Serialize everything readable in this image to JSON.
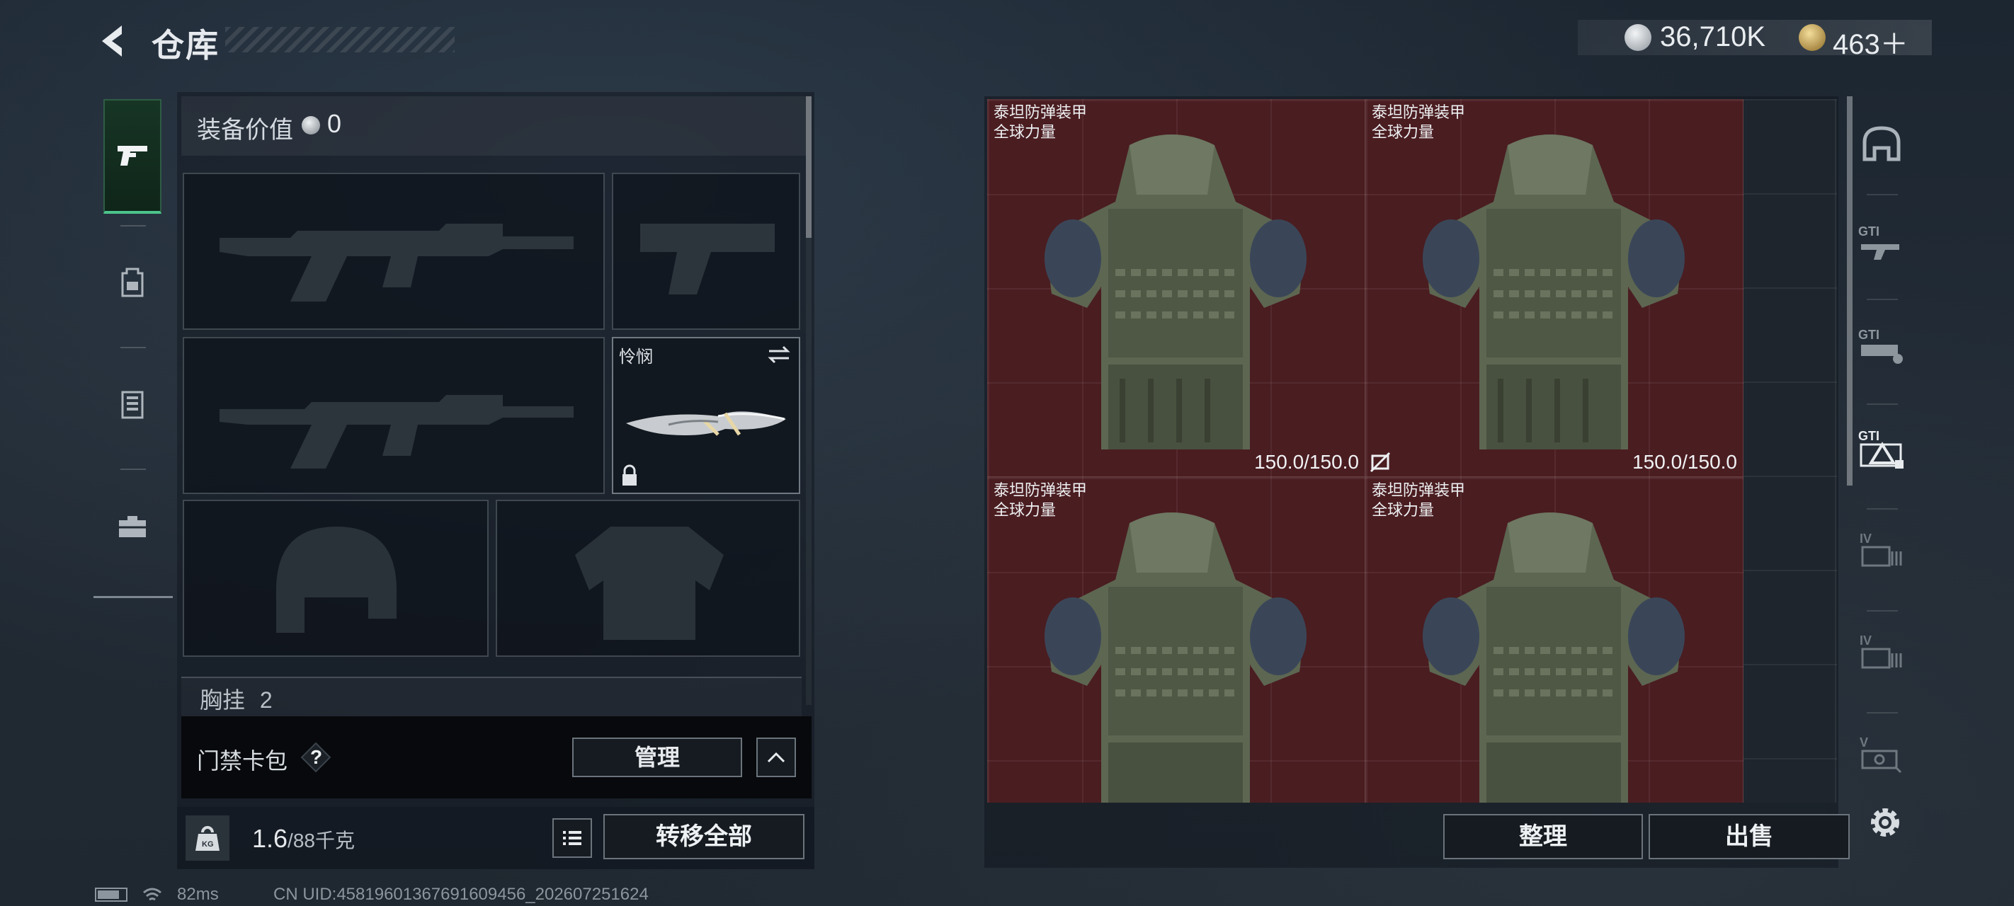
{
  "header": {
    "title": "仓库",
    "currencies": [
      {
        "name": "silver-coin",
        "value": "36,710K",
        "color": "#bfc4c9"
      },
      {
        "name": "gold-coin",
        "value": "463＋",
        "color": "#c9a55a"
      }
    ]
  },
  "side_tabs": [
    {
      "icon": "pistol-icon",
      "active": true
    },
    {
      "icon": "backpack-icon",
      "active": false
    },
    {
      "icon": "rig-icon",
      "active": false
    },
    {
      "icon": "case-icon",
      "active": false
    }
  ],
  "equipment": {
    "value_label": "装备价值",
    "value": "0",
    "knife_name": "怜悯",
    "chest_label": "胸挂",
    "chest_count": "2"
  },
  "keycard": {
    "label": "门禁卡包",
    "help": "?",
    "manage_label": "管理"
  },
  "weight": {
    "current": "1.6",
    "limit": "/88千克",
    "transfer_label": "转移全部"
  },
  "storage": {
    "items": [
      {
        "name": "泰坦防弹装甲",
        "sub": "全球力量",
        "durability": "150.0/150.0"
      },
      {
        "name": "泰坦防弹装甲",
        "sub": "全球力量",
        "durability": "150.0/150.0"
      },
      {
        "name": "泰坦防弹装甲",
        "sub": "全球力量",
        "durability": ""
      },
      {
        "name": "泰坦防弹装甲",
        "sub": "全球力量",
        "durability": ""
      }
    ],
    "sort_label": "整理",
    "sell_label": "出售"
  },
  "right_tabs": [
    {
      "icon": "helmet-storage-icon",
      "label": ""
    },
    {
      "icon": "storage-gti-1-icon",
      "label": "GTI"
    },
    {
      "icon": "storage-gti-2-icon",
      "label": "GTI"
    },
    {
      "icon": "storage-gti-3-icon",
      "label": "GTI"
    },
    {
      "icon": "storage-iv-1-icon",
      "label": "IV"
    },
    {
      "icon": "storage-iv-2-icon",
      "label": "IV"
    },
    {
      "icon": "storage-v-icon",
      "label": "V"
    }
  ],
  "status": {
    "ping": "82ms",
    "uid": "CN UID:4581960136769160945​6_202607251624"
  },
  "colors": {
    "accent_green": "#4cc48a",
    "item_bg": "#4a1d21"
  }
}
